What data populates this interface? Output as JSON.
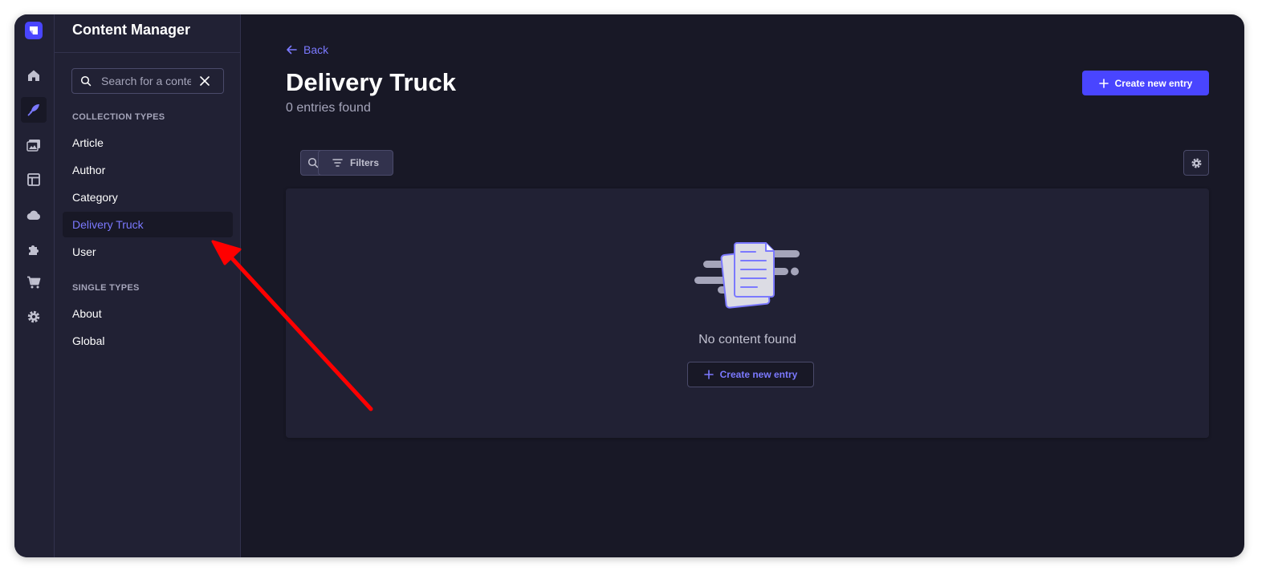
{
  "app": {
    "title": "Content Manager"
  },
  "search": {
    "placeholder": "Search for a content type"
  },
  "sidebar": {
    "collection_label": "COLLECTION TYPES",
    "collection_items": [
      {
        "label": "Article"
      },
      {
        "label": "Author"
      },
      {
        "label": "Category"
      },
      {
        "label": "Delivery Truck",
        "active": true
      },
      {
        "label": "User"
      }
    ],
    "single_label": "SINGLE TYPES",
    "single_items": [
      {
        "label": "About"
      },
      {
        "label": "Global"
      }
    ]
  },
  "rail": {
    "icons": [
      "home-icon",
      "feather-icon",
      "media-library-icon",
      "layout-icon",
      "cloud-icon",
      "puzzle-icon",
      "cart-icon",
      "gear-icon"
    ],
    "active": "feather-icon"
  },
  "header": {
    "back_label": "Back",
    "title": "Delivery Truck",
    "subtitle": "0 entries found",
    "create_label": "Create new entry"
  },
  "toolbar": {
    "filters_label": "Filters"
  },
  "empty_state": {
    "message": "No content found",
    "create_label": "Create new entry"
  },
  "colors": {
    "accent": "#4945ff",
    "accent_text": "#7b79ff",
    "background": "#181826",
    "panel": "#212134",
    "annotation": "#ff0000"
  }
}
